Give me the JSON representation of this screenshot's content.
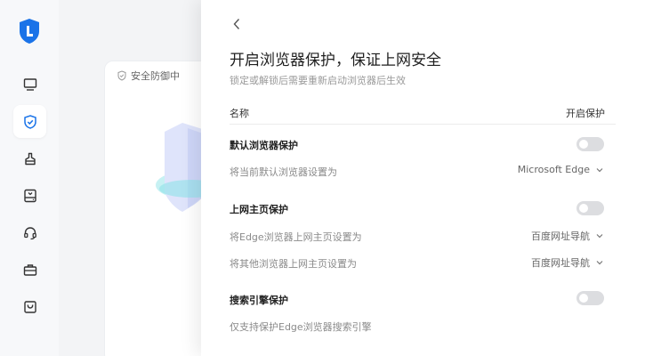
{
  "app": {
    "background_status": "安全防御中"
  },
  "sidebar": {
    "items": [
      {
        "icon": "monitor-icon"
      },
      {
        "icon": "shield-check-icon",
        "active": true
      },
      {
        "icon": "broom-icon"
      },
      {
        "icon": "hard-drive-icon"
      },
      {
        "icon": "headset-icon"
      },
      {
        "icon": "toolbox-icon"
      },
      {
        "icon": "shopping-bag-icon"
      }
    ]
  },
  "panel": {
    "title": "开启浏览器保护，保证上网安全",
    "subtitle": "锁定或解锁后需要重新启动浏览器后生效",
    "header": {
      "name": "名称",
      "switch": "开启保护"
    },
    "sections": [
      {
        "title": "默认浏览器保护",
        "enabled": false,
        "rows": [
          {
            "label": "将当前默认浏览器设置为",
            "value": "Microsoft Edge"
          }
        ]
      },
      {
        "title": "上网主页保护",
        "enabled": false,
        "rows": [
          {
            "label": "将Edge浏览器上网主页设置为",
            "value": "百度网址导航"
          },
          {
            "label": "将其他浏览器上网主页设置为",
            "value": "百度网址导航"
          }
        ]
      },
      {
        "title": "搜索引擎保护",
        "enabled": false,
        "rows": [
          {
            "label": "仅支持保护Edge浏览器搜索引擎"
          }
        ]
      }
    ]
  },
  "colors": {
    "accent": "#1a73e8",
    "toggle_off": "#dcdde0"
  }
}
